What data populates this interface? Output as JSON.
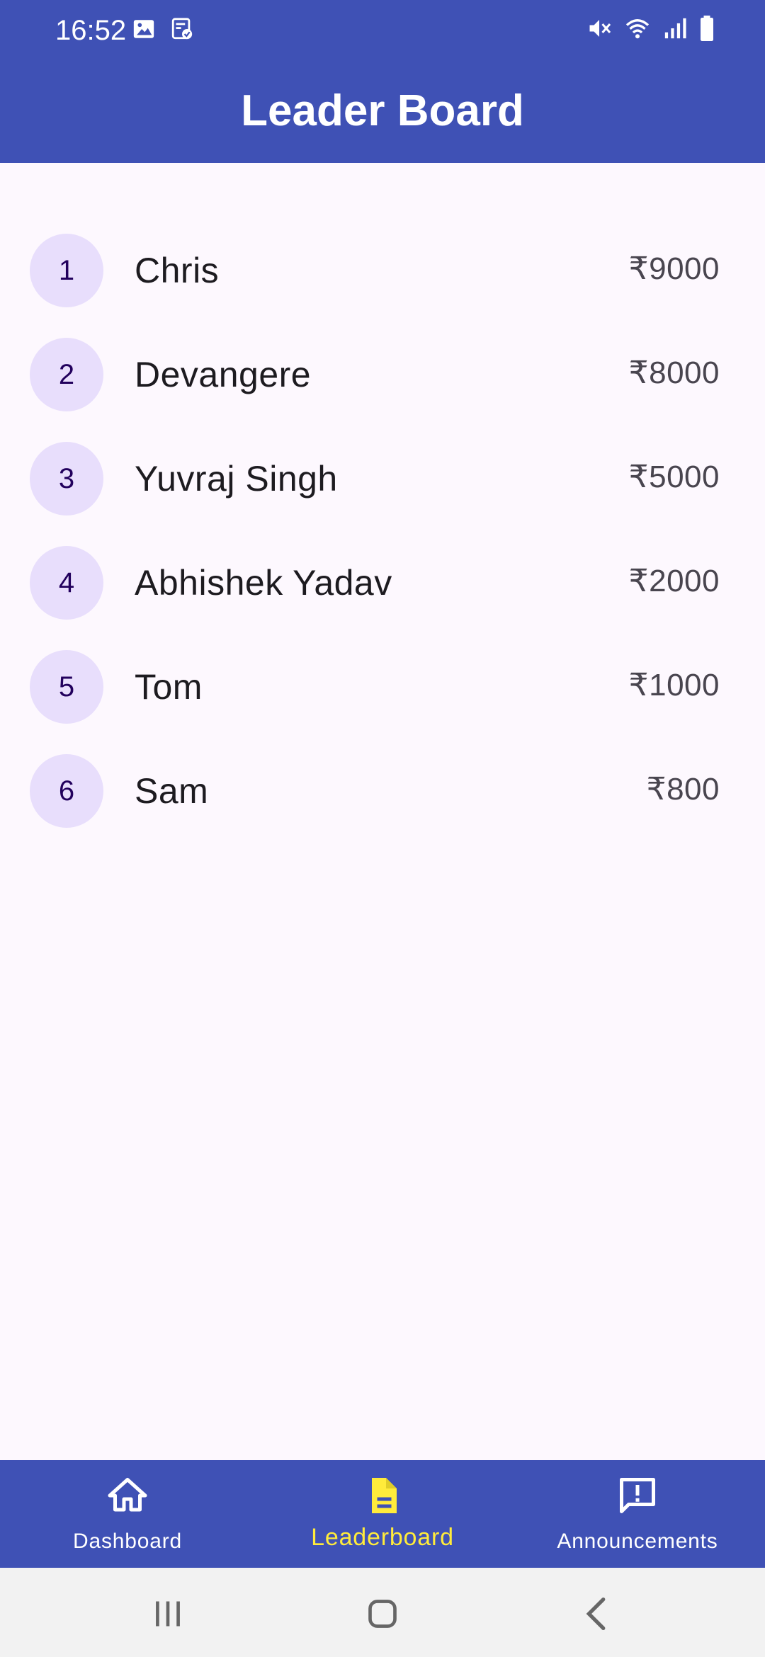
{
  "status_bar": {
    "time": "16:52"
  },
  "app_bar": {
    "title": "Leader Board"
  },
  "leaderboard": {
    "entries": [
      {
        "rank": "1",
        "name": "Chris",
        "amount": "₹9000"
      },
      {
        "rank": "2",
        "name": "Devangere",
        "amount": "₹8000"
      },
      {
        "rank": "3",
        "name": "Yuvraj Singh",
        "amount": "₹5000"
      },
      {
        "rank": "4",
        "name": "Abhishek Yadav",
        "amount": "₹2000"
      },
      {
        "rank": "5",
        "name": "Tom",
        "amount": "₹1000"
      },
      {
        "rank": "6",
        "name": "Sam",
        "amount": "₹800"
      }
    ]
  },
  "bottom_nav": {
    "items": [
      {
        "label": "Dashboard",
        "icon": "home-icon",
        "active": false
      },
      {
        "label": "Leaderboard",
        "icon": "document-icon",
        "active": true
      },
      {
        "label": "Announcements",
        "icon": "announcement-icon",
        "active": false
      }
    ]
  },
  "colors": {
    "primary": "#3f51b5",
    "active_nav": "#ffeb3b",
    "avatar_bg": "#e8defc",
    "background": "#fdf8fe"
  },
  "system_nav": {
    "icons": [
      "recent-apps-icon",
      "home-button-icon",
      "back-icon"
    ]
  }
}
